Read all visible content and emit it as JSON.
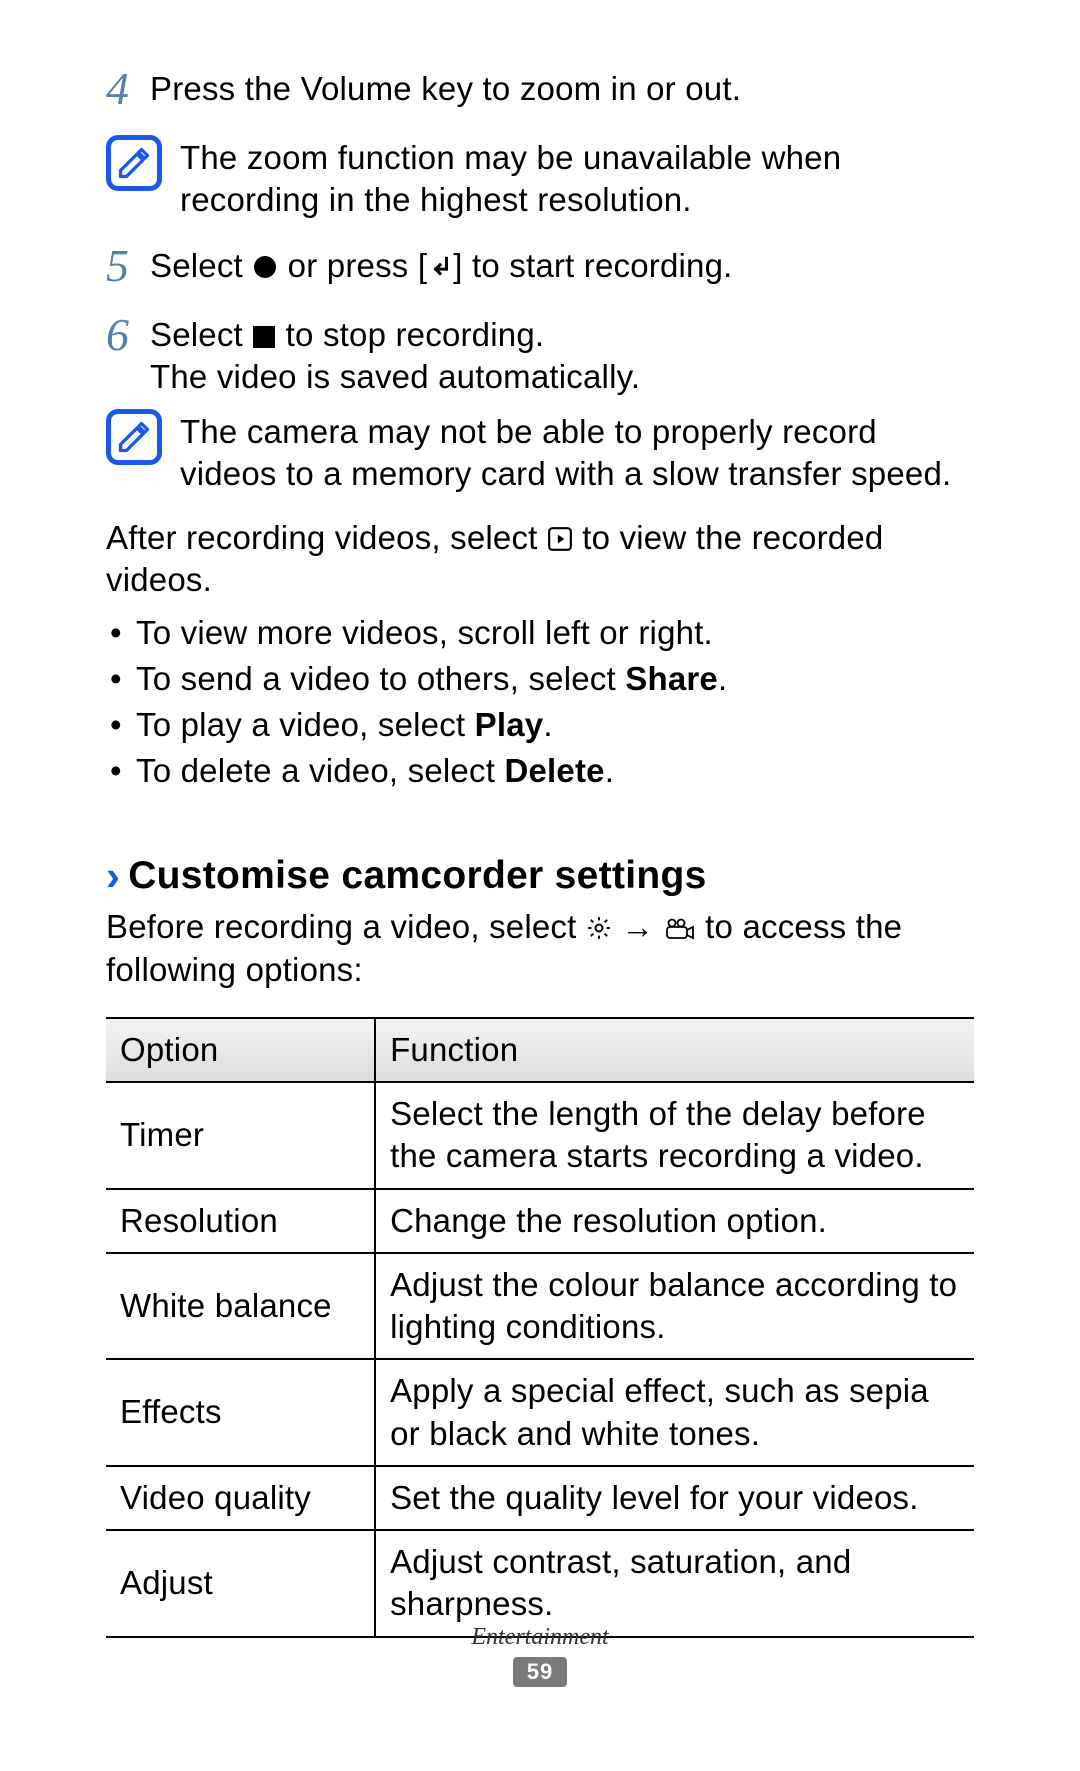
{
  "steps": {
    "s4": {
      "num": "4",
      "text": "Press the Volume key to zoom in or out."
    },
    "s5": {
      "num": "5",
      "pre": "Select ",
      "mid": " or press [",
      "post": "] to start recording."
    },
    "s6": {
      "num": "6",
      "line1_pre": "Select ",
      "line1_post": " to stop recording.",
      "line2": "The video is saved automatically."
    }
  },
  "notes": {
    "n1": "The zoom function may be unavailable when recording in the highest resolution.",
    "n2": "The camera may not be able to properly record videos to a memory card with a slow transfer speed."
  },
  "after": {
    "pre": "After recording videos, select ",
    "post": " to view the recorded videos."
  },
  "bullets": {
    "b1": "To view more videos, scroll left or right.",
    "b2_pre": "To send a video to others, select ",
    "b2_bold": "Share",
    "b2_post": ".",
    "b3_pre": "To play a video, select ",
    "b3_bold": "Play",
    "b3_post": ".",
    "b4_pre": "To delete a video, select ",
    "b4_bold": "Delete",
    "b4_post": "."
  },
  "heading": "Customise camcorder settings",
  "intro": {
    "pre": "Before recording a video, select ",
    "arrow": " → ",
    "post": " to access the following options:"
  },
  "table": {
    "headers": {
      "option": "Option",
      "function": "Function"
    },
    "rows": [
      {
        "option": "Timer",
        "function": "Select the length of the delay before the camera starts recording a video."
      },
      {
        "option": "Resolution",
        "function": "Change the resolution option."
      },
      {
        "option": "White balance",
        "function": "Adjust the colour balance according to lighting conditions."
      },
      {
        "option": "Effects",
        "function": "Apply a special effect, such as sepia or black and white tones."
      },
      {
        "option": "Video quality",
        "function": "Set the quality level for your videos."
      },
      {
        "option": "Adjust",
        "function": "Adjust contrast, saturation, and sharpness."
      }
    ]
  },
  "footer": {
    "category": "Entertainment",
    "page": "59"
  }
}
